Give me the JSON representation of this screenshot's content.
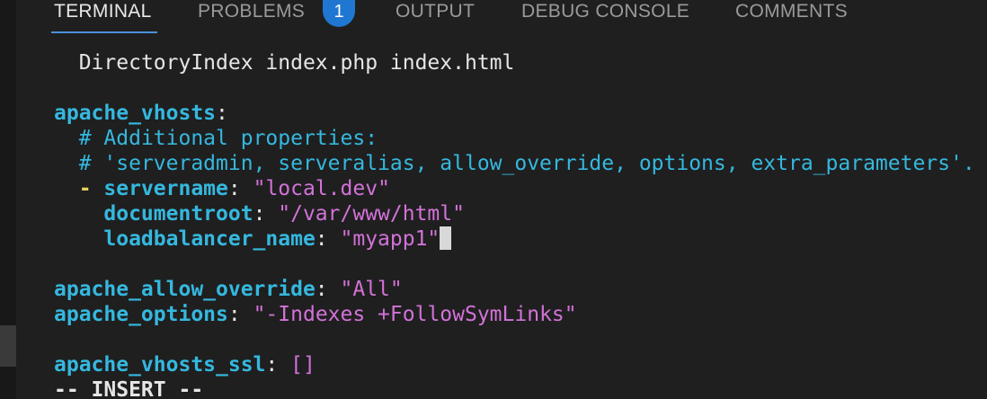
{
  "panel": {
    "tabs": [
      {
        "label": "TERMINAL",
        "active": true
      },
      {
        "label": "PROBLEMS",
        "active": false,
        "badge": "1"
      },
      {
        "label": "OUTPUT",
        "active": false
      },
      {
        "label": "DEBUG CONSOLE",
        "active": false
      },
      {
        "label": "COMMENTS",
        "active": false
      }
    ]
  },
  "terminal": {
    "indent": "  ",
    "indent2": "    ",
    "l1": {
      "text": "DirectoryIndex index.php index.html"
    },
    "l2": {
      "key": "apache_vhosts",
      "colon": ":"
    },
    "l3": {
      "comment": "# Additional properties:"
    },
    "l4": {
      "comment": "# 'serveradmin, serveralias, allow_override, options, extra_parameters'."
    },
    "l5": {
      "dash": "- ",
      "key": "servername",
      "colon": ": ",
      "value": "\"local.dev\""
    },
    "l6": {
      "key": "documentroot",
      "colon": ": ",
      "value": "\"/var/www/html\""
    },
    "l7": {
      "key": "loadbalancer_name",
      "colon": ": ",
      "value": "\"myapp1\""
    },
    "l8": {
      "key": "apache_allow_override",
      "colon": ": ",
      "value": "\"All\""
    },
    "l9": {
      "key": "apache_options",
      "colon": ": ",
      "value": "\"-Indexes +FollowSymLinks\""
    },
    "l10": {
      "key": "apache_vhosts_ssl",
      "colon": ": ",
      "value": "[]"
    },
    "mode": "-- INSERT --"
  },
  "colors": {
    "background": "#1f1f1f",
    "yaml_key": "#35b8df",
    "yaml_string": "#d372d8",
    "yaml_dash": "#e5d15a",
    "tab_active_underline": "#4a90d9",
    "badge": "#1f77d2"
  }
}
